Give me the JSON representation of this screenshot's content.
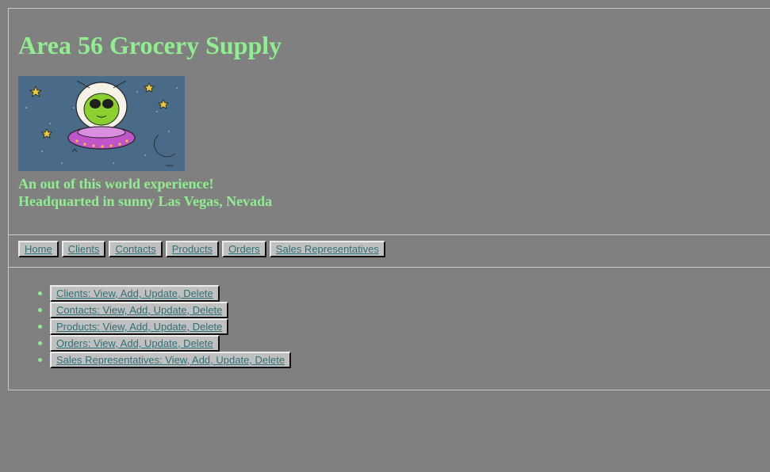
{
  "header": {
    "title": "Area 56 Grocery Supply",
    "tagline1": "An out of this world experience!",
    "tagline2": "Headquarted in sunny Las Vegas, Nevada",
    "logo_icon": "alien-in-ufo-logo"
  },
  "nav": {
    "items": [
      {
        "label": "Home"
      },
      {
        "label": "Clients"
      },
      {
        "label": "Contacts"
      },
      {
        "label": "Products"
      },
      {
        "label": "Orders"
      },
      {
        "label": "Sales Representatives"
      }
    ]
  },
  "main": {
    "links": [
      {
        "label": "Clients: View, Add, Update, Delete"
      },
      {
        "label": "Contacts: View, Add, Update, Delete"
      },
      {
        "label": "Products: View, Add, Update, Delete"
      },
      {
        "label": "Orders: View, Add, Update, Delete"
      },
      {
        "label": "Sales Representatives: View, Add, Update, Delete"
      }
    ]
  },
  "colors": {
    "background": "#808080",
    "accent_text": "#90ee90",
    "link_text": "#2f6f73",
    "button_face": "#c0c0c0"
  }
}
